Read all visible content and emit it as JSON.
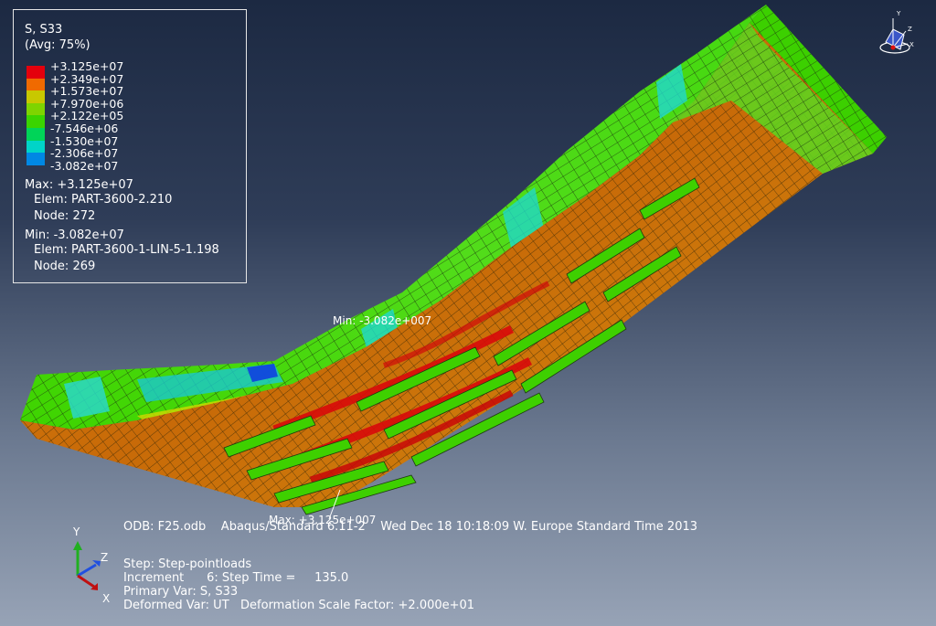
{
  "legend": {
    "variable": "S, S33",
    "averaging": "(Avg: 75%)",
    "levels": [
      "+3.125e+07",
      "+2.349e+07",
      "+1.573e+07",
      "+7.970e+06",
      "+2.122e+05",
      "-7.546e+06",
      "-1.530e+07",
      "-2.306e+07",
      "-3.082e+07"
    ],
    "colors": [
      "#e4000c",
      "#f06a00",
      "#c8c800",
      "#7ed400",
      "#3ad400",
      "#00d458",
      "#00d4c8",
      "#0088e4",
      "#0012d8"
    ],
    "max": {
      "label": "Max: +3.125e+07",
      "elem": "Elem: PART-3600-2.210",
      "node": "Node: 272"
    },
    "min": {
      "label": "Min: -3.082e+07",
      "elem": "Elem: PART-3600-1-LIN-5-1.198",
      "node": "Node: 269"
    }
  },
  "annotations": {
    "min": "Min: -3.082e+007",
    "max": "Max: +3.125e+007"
  },
  "status": {
    "odb": "ODB: F25.odb    Abaqus/Standard 6.11-2    Wed Dec 18 10:18:09 W. Europe Standard Time 2013",
    "step": "Step: Step-pointloads",
    "increment": "Increment      6: Step Time =     135.0",
    "primary": "Primary Var: S, S33",
    "deformed": "Deformed Var: UT   Deformation Scale Factor: +2.000e+01"
  },
  "triad": {
    "y": "Y",
    "z": "Z",
    "x": "X"
  },
  "viewcube_labels": {
    "y": "Y",
    "z": "Z",
    "x": "X"
  }
}
